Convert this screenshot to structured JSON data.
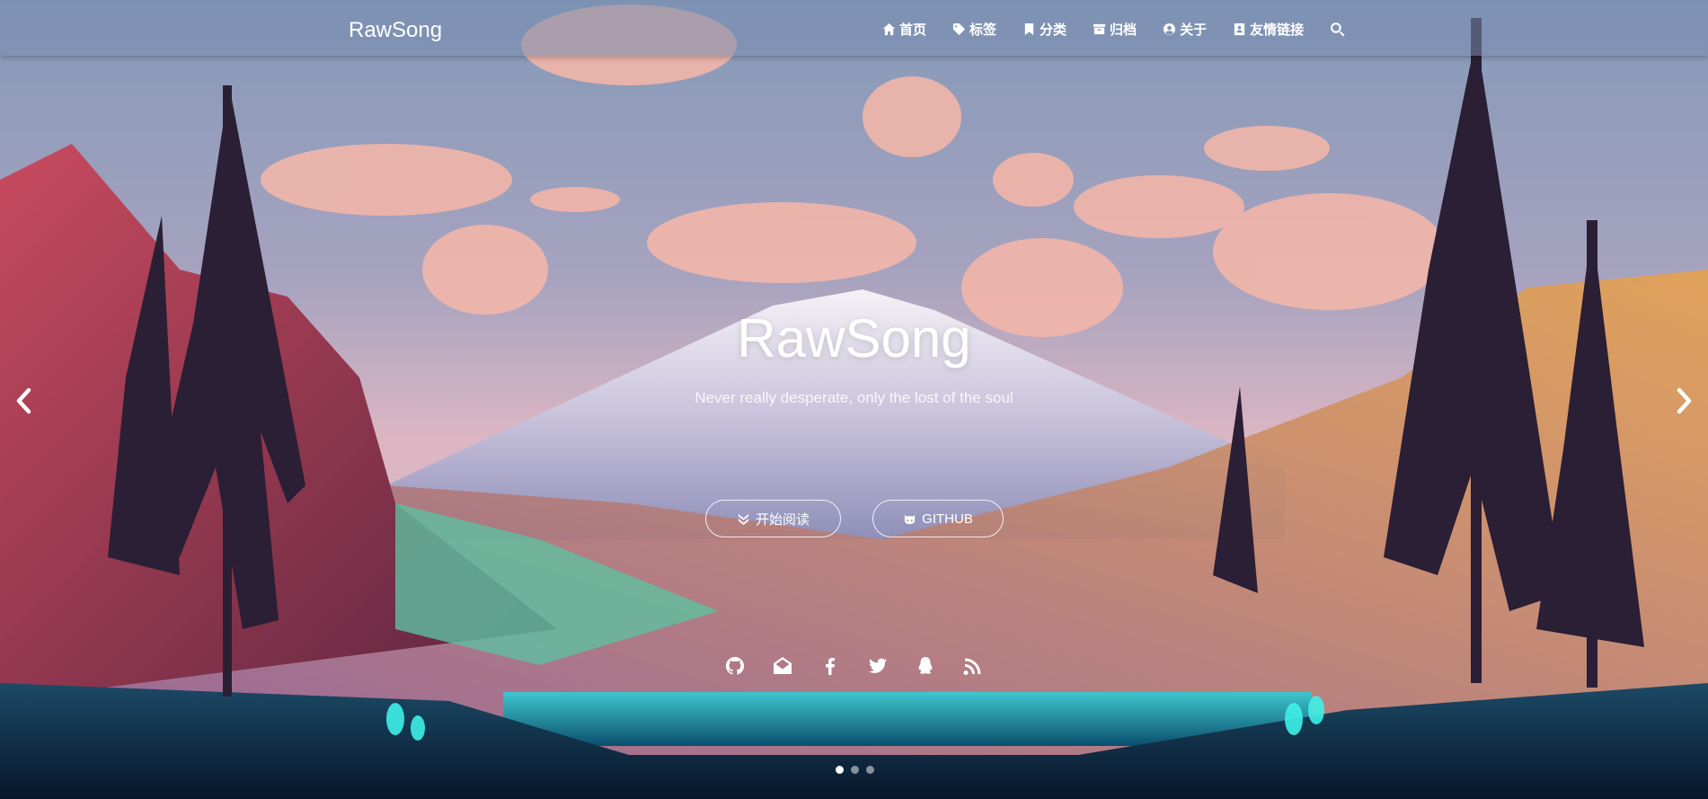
{
  "header": {
    "brand": "RawSong",
    "nav": [
      {
        "label": "首页",
        "icon": "home-icon"
      },
      {
        "label": "标签",
        "icon": "tag-icon"
      },
      {
        "label": "分类",
        "icon": "bookmark-icon"
      },
      {
        "label": "归档",
        "icon": "archive-icon"
      },
      {
        "label": "关于",
        "icon": "user-circle-icon"
      },
      {
        "label": "友情链接",
        "icon": "address-book-icon"
      }
    ],
    "search_icon": "search-icon"
  },
  "hero": {
    "title": "RawSong",
    "subtitle": "Never really desperate, only the lost of the soul",
    "buttons": {
      "read_label": "开始阅读",
      "github_label": "GITHUB"
    },
    "social_icons": [
      "github-icon",
      "envelope-open-icon",
      "facebook-icon",
      "twitter-icon",
      "qq-icon",
      "rss-icon"
    ]
  },
  "carousel": {
    "slide_count": 3,
    "active_index": 0
  },
  "colors": {
    "navbar_bg": "#788caf",
    "text": "#ffffff"
  }
}
